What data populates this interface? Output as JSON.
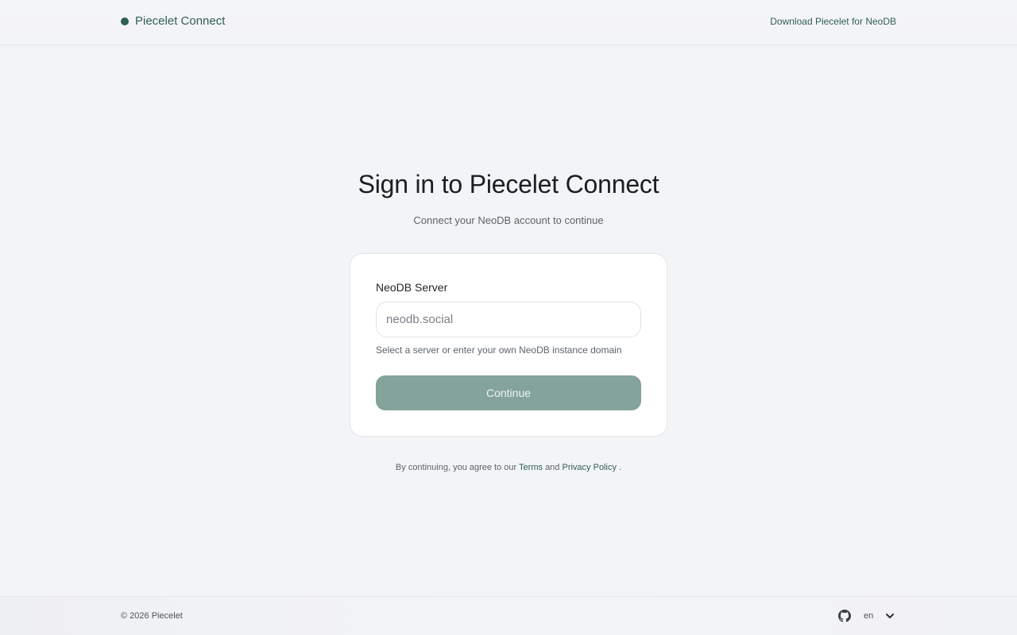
{
  "header": {
    "brand": "Piecelet Connect",
    "download_link": "Download Piecelet for NeoDB"
  },
  "main": {
    "title": "Sign in to Piecelet Connect",
    "subtitle": "Connect your NeoDB account to continue",
    "form": {
      "label": "NeoDB Server",
      "input_value": "",
      "input_placeholder": "neodb.social",
      "helper": "Select a server or enter your own NeoDB instance domain",
      "continue_label": "Continue"
    },
    "legal": {
      "prefix": "By continuing, you agree to our",
      "terms": "Terms",
      "conjunction": "and",
      "privacy": "Privacy Policy",
      "suffix": "."
    }
  },
  "footer": {
    "copyright": "© 2026 Piecelet",
    "github_icon": "github-icon",
    "language": "en",
    "chevron_icon": "chevron-down-icon"
  },
  "colors": {
    "accent": "#2f5f55",
    "button_disabled": "#83a39b",
    "background": "#f3f4f6"
  }
}
